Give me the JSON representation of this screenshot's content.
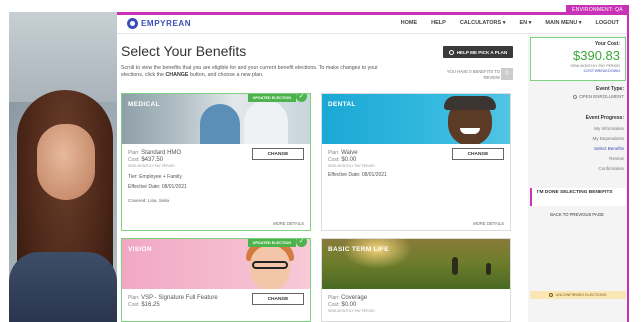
{
  "environment_tag": "ENVIRONMENT: QA",
  "header": {
    "logo_text": "EMPYREAN",
    "nav": [
      "HOME",
      "HELP",
      "CALCULATORS ▾",
      "EN ▾",
      "MAIN MENU ▾",
      "LOGOUT"
    ]
  },
  "main": {
    "title": "Select Your Benefits",
    "intro_pre": "Scroll to view the benefits that you are eligible for and your current benefit elections. To make changes to your elections, click the ",
    "intro_bold": "CHANGE",
    "intro_post": " button, and choose a new plan.",
    "help_button": "HELP ME PICK A PLAN",
    "review_text": "YOU HAVE 0 BENEFITS TO REVIEW",
    "review_count": "0"
  },
  "cards": [
    {
      "label": "MEDICAL",
      "optout": "UPDATED ELECTION",
      "plan_label": "Plan:",
      "plan": "Standard HMO",
      "cost_label": "Cost:",
      "cost": "$437.50",
      "semi": "SEMI-MONTHLY PAY PERIOD",
      "tier": "Tier: Employee + Family",
      "effective": "Effective Date: 08/01/2021",
      "covered": "Covered:  Lisa, Selia",
      "change": "CHANGE",
      "more": "MORE DETAILS"
    },
    {
      "label": "DENTAL",
      "plan_label": "Plan:",
      "plan": "Waive",
      "cost_label": "Cost:",
      "cost": "$0.00",
      "semi": "SEMI-MONTHLY PAY PERIOD",
      "effective": "Effective Date: 08/01/2021",
      "change": "CHANGE",
      "more": "MORE DETAILS"
    },
    {
      "label": "VISION",
      "optout": "UPDATED ELECTION",
      "plan_label": "Plan:",
      "plan": "VSP - Signature Full Feature",
      "cost_label": "Cost:",
      "cost": "$16.25",
      "change": "CHANGE"
    },
    {
      "label": "BASIC TERM LIFE",
      "plan_label": "Plan:",
      "plan": "Coverage",
      "cost_label": "Cost:",
      "cost": "$0.00",
      "semi": "SEMI-MONTHLY PAY PERIOD"
    }
  ],
  "sidebar": {
    "cost_label": "Your Cost:",
    "cost_value": "$390.83",
    "cost_semi": "SEMI-MONTHLY PAY PERIOD",
    "cost_breakdown": "COST BREAKDOWN",
    "event_type_label": "Event Type:",
    "event_type_value": "OPEN ENROLLMENT",
    "progress_label": "Event Progress:",
    "steps": [
      "My Information",
      "My Dependents",
      "Select Benefits",
      "Review",
      "Confirmation"
    ],
    "done_button": "I'M DONE SELECTING BENEFITS",
    "back_link": "BACK TO PREVIOUS PAGE",
    "unconfirmed": "UNCONFIRMED ELECTIONS"
  },
  "colors": {
    "accent": "#c932b7",
    "brand": "#3b4fb6",
    "success": "#4db34d",
    "cost_green": "#3aa63a"
  }
}
